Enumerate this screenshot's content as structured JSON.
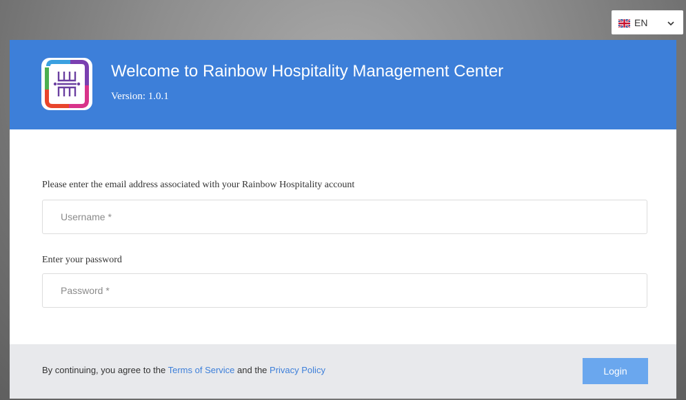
{
  "language": {
    "code": "EN",
    "flag_icon": "uk-flag-icon"
  },
  "header": {
    "title": "Welcome to Rainbow Hospitality Management Center",
    "version": "Version: 1.0.1",
    "background": "#3d7fd9"
  },
  "form": {
    "username_prompt": "Please enter the email address associated with your Rainbow Hospitality account",
    "username_placeholder": "Username *",
    "password_prompt": "Enter your password",
    "password_placeholder": "Password *"
  },
  "footer": {
    "agree_prefix": "By continuing, you agree to the ",
    "terms_link": "Terms of Service",
    "agree_middle": " and the ",
    "privacy_link": "Privacy Policy",
    "login_label": "Login",
    "login_color": "#6aa7ee",
    "link_color": "#3d7fd9"
  }
}
